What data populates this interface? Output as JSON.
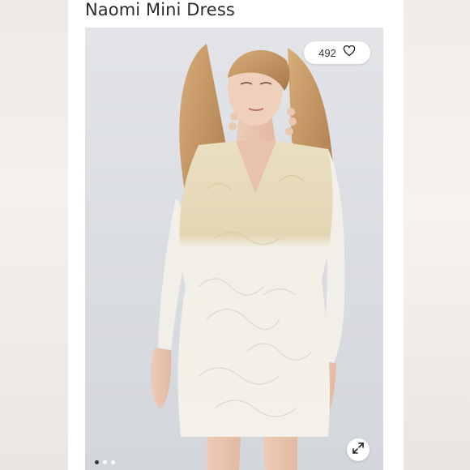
{
  "listing": {
    "title": "Naomi Mini Dress",
    "likes": "492",
    "photo_alt": "Model wearing cream long-sleeve V-neck jacquard mini dress"
  },
  "carousel": {
    "slide_count": 3,
    "active_index": 0
  },
  "icons": {
    "like": "heart-outline-icon",
    "expand": "expand-arrows-icon"
  },
  "colors": {
    "dress": "#efe9d8",
    "hair": "#c89a62",
    "background": "#d8dbe0"
  }
}
